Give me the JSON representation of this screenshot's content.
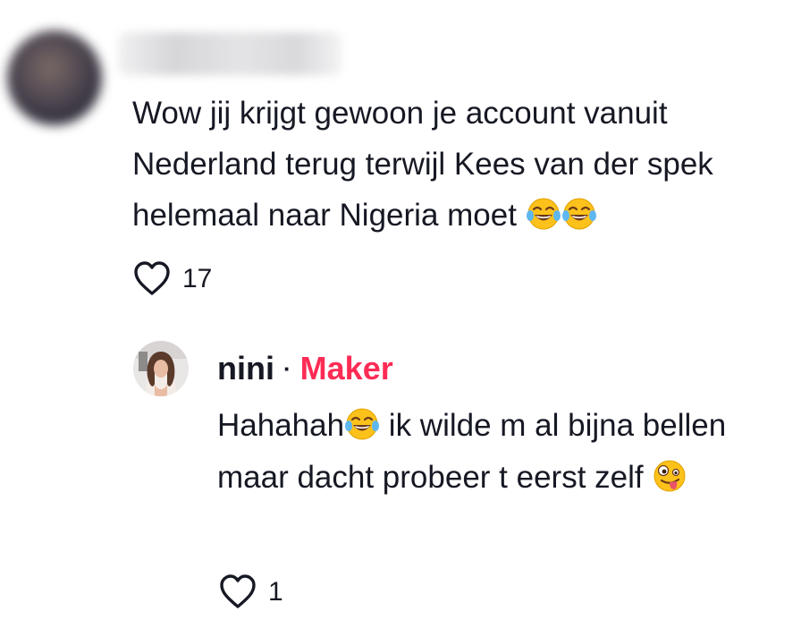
{
  "comments": [
    {
      "username": "dsbarry96",
      "text_part1": "Wow jij krijgt gewoon je account vanuit Nederland terug terwijl Kees van der spek helemaal naar Nigeria moet ",
      "text_emojis": [
        "😂",
        "😂"
      ],
      "likes": "17",
      "icons": {
        "avatar": "blurred-avatar",
        "like": "heart-outline-icon"
      }
    }
  ],
  "reply": {
    "username": "nini",
    "separator": "·",
    "badge": "Maker",
    "text_part1": "Hahahah",
    "text_emoji1": "😂",
    "text_part2": " ik wilde m al bijna bellen maar dacht probeer t eerst zelf ",
    "text_emoji2": "🤪",
    "likes": "1",
    "icons": {
      "avatar": "user-avatar",
      "like": "heart-outline-icon"
    }
  },
  "colors": {
    "text": "#161823",
    "badge": "#fe2c55"
  }
}
